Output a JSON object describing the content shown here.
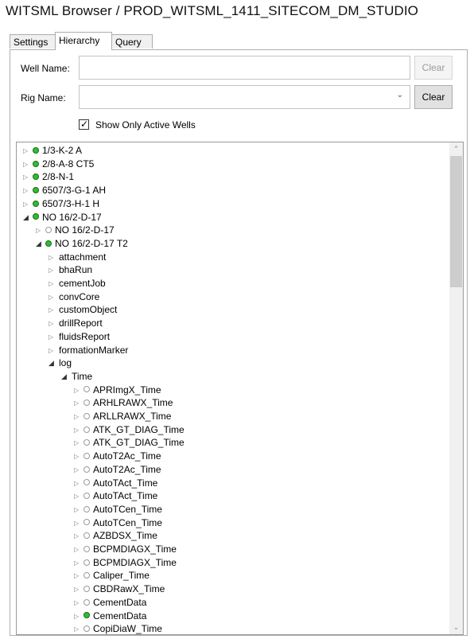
{
  "window": {
    "title": "WITSML Browser / PROD_WITSML_1411_SITECOM_DM_STUDIO"
  },
  "tabs": [
    "Settings",
    "Hierarchy",
    "Query"
  ],
  "active_tab": "Hierarchy",
  "filters": {
    "well_name_label": "Well Name:",
    "well_name_value": "",
    "well_clear_label": "Clear",
    "rig_name_label": "Rig Name:",
    "rig_name_value": "",
    "rig_clear_label": "Clear",
    "active_wells_label": "Show Only Active Wells",
    "active_wells_checked": true
  },
  "colors": {
    "active_dot": "#2fbd32",
    "inactive_dot": "#ffffff"
  },
  "tree": [
    {
      "label": "1/3-K-2 A",
      "level": 0,
      "expander": "collapsed",
      "status": "active"
    },
    {
      "label": "2/8-A-8 CT5",
      "level": 0,
      "expander": "collapsed",
      "status": "active"
    },
    {
      "label": "2/8-N-1",
      "level": 0,
      "expander": "collapsed",
      "status": "active"
    },
    {
      "label": "6507/3-G-1 AH",
      "level": 0,
      "expander": "collapsed",
      "status": "active"
    },
    {
      "label": "6507/3-H-1 H",
      "level": 0,
      "expander": "collapsed",
      "status": "active"
    },
    {
      "label": "NO 16/2-D-17",
      "level": 0,
      "expander": "expanded",
      "status": "active"
    },
    {
      "label": "NO 16/2-D-17",
      "level": 1,
      "expander": "collapsed",
      "status": "inactive"
    },
    {
      "label": "NO 16/2-D-17 T2",
      "level": 1,
      "expander": "expanded",
      "status": "active"
    },
    {
      "label": "attachment",
      "level": 2,
      "expander": "collapsed",
      "status": "none"
    },
    {
      "label": "bhaRun",
      "level": 2,
      "expander": "collapsed",
      "status": "none"
    },
    {
      "label": "cementJob",
      "level": 2,
      "expander": "collapsed",
      "status": "none"
    },
    {
      "label": "convCore",
      "level": 2,
      "expander": "collapsed",
      "status": "none"
    },
    {
      "label": "customObject",
      "level": 2,
      "expander": "collapsed",
      "status": "none"
    },
    {
      "label": "drillReport",
      "level": 2,
      "expander": "collapsed",
      "status": "none"
    },
    {
      "label": "fluidsReport",
      "level": 2,
      "expander": "collapsed",
      "status": "none"
    },
    {
      "label": "formationMarker",
      "level": 2,
      "expander": "collapsed",
      "status": "none"
    },
    {
      "label": "log",
      "level": 2,
      "expander": "expanded",
      "status": "none"
    },
    {
      "label": "Time",
      "level": 3,
      "expander": "expanded",
      "status": "none"
    },
    {
      "label": "APRImgX_Time",
      "level": 4,
      "expander": "collapsed",
      "status": "inactive"
    },
    {
      "label": "ARHLRAWX_Time",
      "level": 4,
      "expander": "collapsed",
      "status": "inactive"
    },
    {
      "label": "ARLLRAWX_Time",
      "level": 4,
      "expander": "collapsed",
      "status": "inactive"
    },
    {
      "label": "ATK_GT_DIAG_Time",
      "level": 4,
      "expander": "collapsed",
      "status": "inactive"
    },
    {
      "label": "ATK_GT_DIAG_Time",
      "level": 4,
      "expander": "collapsed",
      "status": "inactive"
    },
    {
      "label": "AutoT2Ac_Time",
      "level": 4,
      "expander": "collapsed",
      "status": "inactive"
    },
    {
      "label": "AutoT2Ac_Time",
      "level": 4,
      "expander": "collapsed",
      "status": "inactive"
    },
    {
      "label": "AutoTAct_Time",
      "level": 4,
      "expander": "collapsed",
      "status": "inactive"
    },
    {
      "label": "AutoTAct_Time",
      "level": 4,
      "expander": "collapsed",
      "status": "inactive"
    },
    {
      "label": "AutoTCen_Time",
      "level": 4,
      "expander": "collapsed",
      "status": "inactive"
    },
    {
      "label": "AutoTCen_Time",
      "level": 4,
      "expander": "collapsed",
      "status": "inactive"
    },
    {
      "label": "AZBDSX_Time",
      "level": 4,
      "expander": "collapsed",
      "status": "inactive"
    },
    {
      "label": "BCPMDIAGX_Time",
      "level": 4,
      "expander": "collapsed",
      "status": "inactive"
    },
    {
      "label": "BCPMDIAGX_Time",
      "level": 4,
      "expander": "collapsed",
      "status": "inactive"
    },
    {
      "label": "Caliper_Time",
      "level": 4,
      "expander": "collapsed",
      "status": "inactive"
    },
    {
      "label": "CBDRawX_Time",
      "level": 4,
      "expander": "collapsed",
      "status": "inactive"
    },
    {
      "label": "CementData",
      "level": 4,
      "expander": "collapsed",
      "status": "inactive"
    },
    {
      "label": "CementData",
      "level": 4,
      "expander": "collapsed",
      "status": "active"
    },
    {
      "label": "CopiDiaW_Time",
      "level": 4,
      "expander": "collapsed",
      "status": "inactive"
    }
  ]
}
